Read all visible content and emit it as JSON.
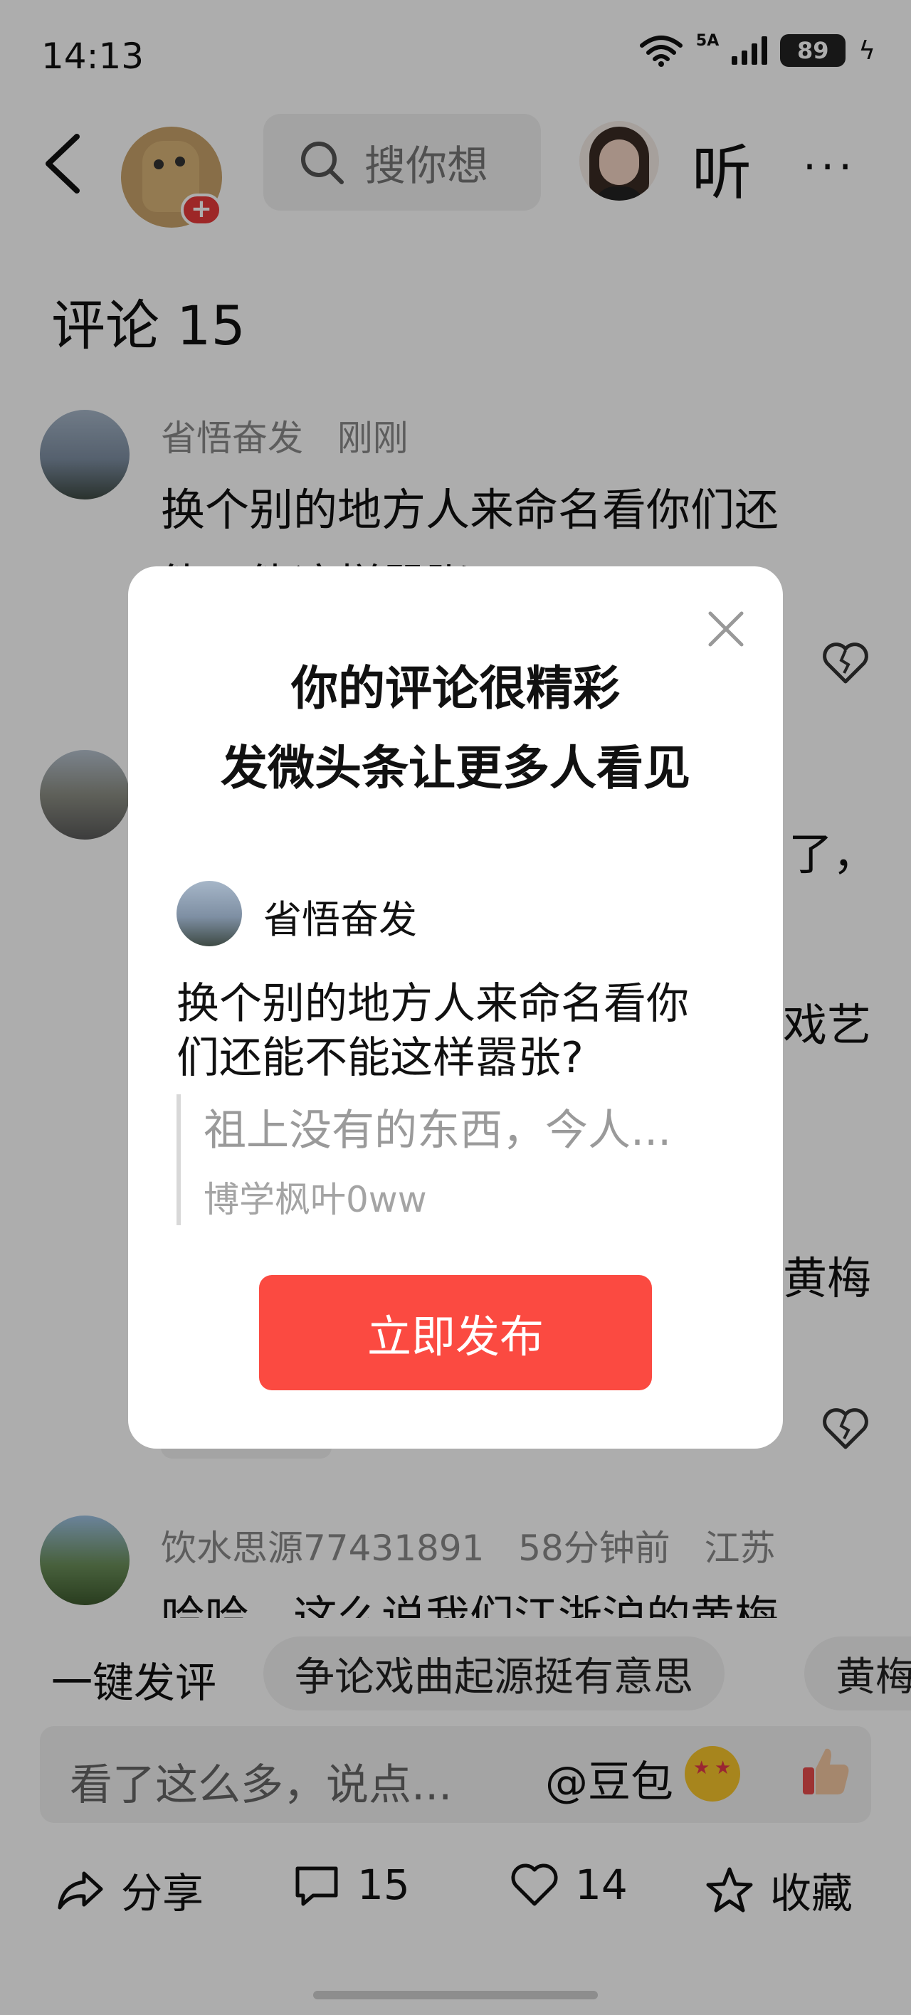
{
  "status_bar": {
    "time": "14:13",
    "network": "5A",
    "battery": "89"
  },
  "nav": {
    "search_placeholder": "搜你想",
    "listen_label": "听",
    "more_label": "···"
  },
  "comments": {
    "title": "评论 15",
    "items": [
      {
        "user": "省悟奋发",
        "time": "刚刚",
        "text": "换个别的地方人来命名看你们还",
        "text_partial": "能不能这样嚣张?"
      },
      {
        "user": "饮水思源77431891",
        "time": "58分钟前",
        "location": "江苏",
        "text": "哈哈，这么说我们江浙沪的黄梅"
      }
    ],
    "background_fragments": [
      "了，",
      "戏艺",
      "黄梅"
    ]
  },
  "suggestions": {
    "label": "一键发评",
    "chips": [
      "争论戏曲起源挺有意思",
      "黄梅"
    ]
  },
  "input": {
    "placeholder": "看了这么多，说点...",
    "mention": "@豆包"
  },
  "actions": {
    "share": "分享",
    "comment_count": "15",
    "like_count": "14",
    "favorite": "收藏"
  },
  "modal": {
    "headline_1": "你的评论很精彩",
    "headline_2": "发微头条让更多人看见",
    "quoted_user": "省悟奋发",
    "quoted_text_1": "换个别的地方人来命名看你",
    "quoted_text_2": "们还能不能这样嚣张?",
    "reply_excerpt": "祖上没有的东西，今人...",
    "reply_author": "博学枫叶0ww",
    "publish_label": "立即发布"
  }
}
